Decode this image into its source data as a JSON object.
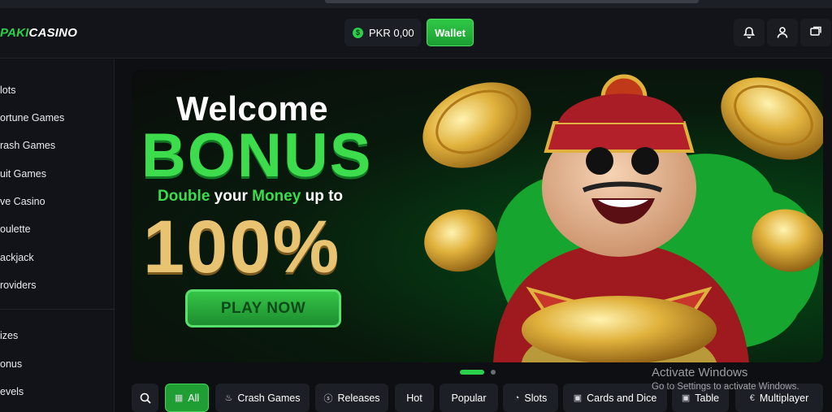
{
  "header": {
    "logo_green": "PAKI",
    "logo_white": "CASINO",
    "balance": "PKR 0,00",
    "currency_symbol": "$",
    "wallet_label": "Wallet",
    "icons": [
      "bell-icon",
      "user-icon",
      "chat-icon"
    ]
  },
  "sidebar": {
    "items": [
      "lots",
      "ortune Games",
      "rash Games",
      "uit Games",
      "ve Casino",
      "oulette",
      "ackjack",
      "roviders"
    ],
    "items2": [
      "izes",
      "onus",
      "evels"
    ]
  },
  "banner": {
    "welcome": "Welcome",
    "bonus": "BONUS",
    "line_g1": "Double",
    "line_w1": " your ",
    "line_g2": "Money",
    "line_w2": " up to",
    "percent": "100%",
    "play": "PLAY NOW"
  },
  "categories": [
    {
      "label": "",
      "icon": "search-icon"
    },
    {
      "label": "All",
      "icon": "grid-icon",
      "active": true
    },
    {
      "label": "Crash Games",
      "icon": "flame-icon"
    },
    {
      "label": "Releases",
      "icon": "dollar-icon"
    },
    {
      "label": "Hot",
      "icon": ""
    },
    {
      "label": "Popular",
      "icon": ""
    },
    {
      "label": "Slots",
      "icon": "slots-icon"
    },
    {
      "label": "Cards and Dice",
      "icon": "cards-icon"
    },
    {
      "label": "Table",
      "icon": "camera-icon"
    },
    {
      "label": "Multiplayer",
      "icon": "euro-icon"
    }
  ],
  "watermark": {
    "line1": "Activate Windows",
    "line2": "Go to Settings to activate Windows."
  },
  "colors": {
    "accent": "#2bd14a",
    "gold": "#e8c472",
    "bg": "#0e0f13"
  }
}
